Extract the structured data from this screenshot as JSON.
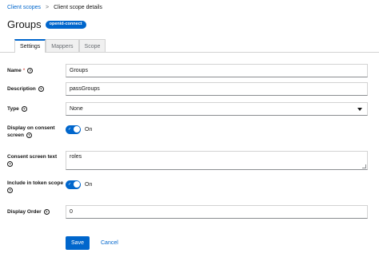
{
  "breadcrumb": {
    "parent": "Client scopes",
    "separator": ">",
    "current": "Client scope details"
  },
  "header": {
    "title": "Groups",
    "badge": "openid-connect"
  },
  "tabs": [
    {
      "label": "Settings"
    },
    {
      "label": "Mappers"
    },
    {
      "label": "Scope"
    }
  ],
  "form": {
    "name": {
      "label": "Name",
      "required_mark": "*",
      "value": "Groups"
    },
    "description": {
      "label": "Description",
      "value": "passGroups"
    },
    "type": {
      "label": "Type",
      "value": "None"
    },
    "display_on_consent": {
      "label_line1": "Display on consent",
      "label_line2": "screen",
      "state": "On"
    },
    "consent_text": {
      "label": "Consent screen text",
      "value": "roles"
    },
    "include_in_token": {
      "label": "Include in token scope",
      "state": "On"
    },
    "display_order": {
      "label": "Display Order",
      "value": "0"
    }
  },
  "actions": {
    "save": "Save",
    "cancel": "Cancel"
  },
  "colors": {
    "accent": "#0066cc",
    "required": "#c9190b"
  }
}
